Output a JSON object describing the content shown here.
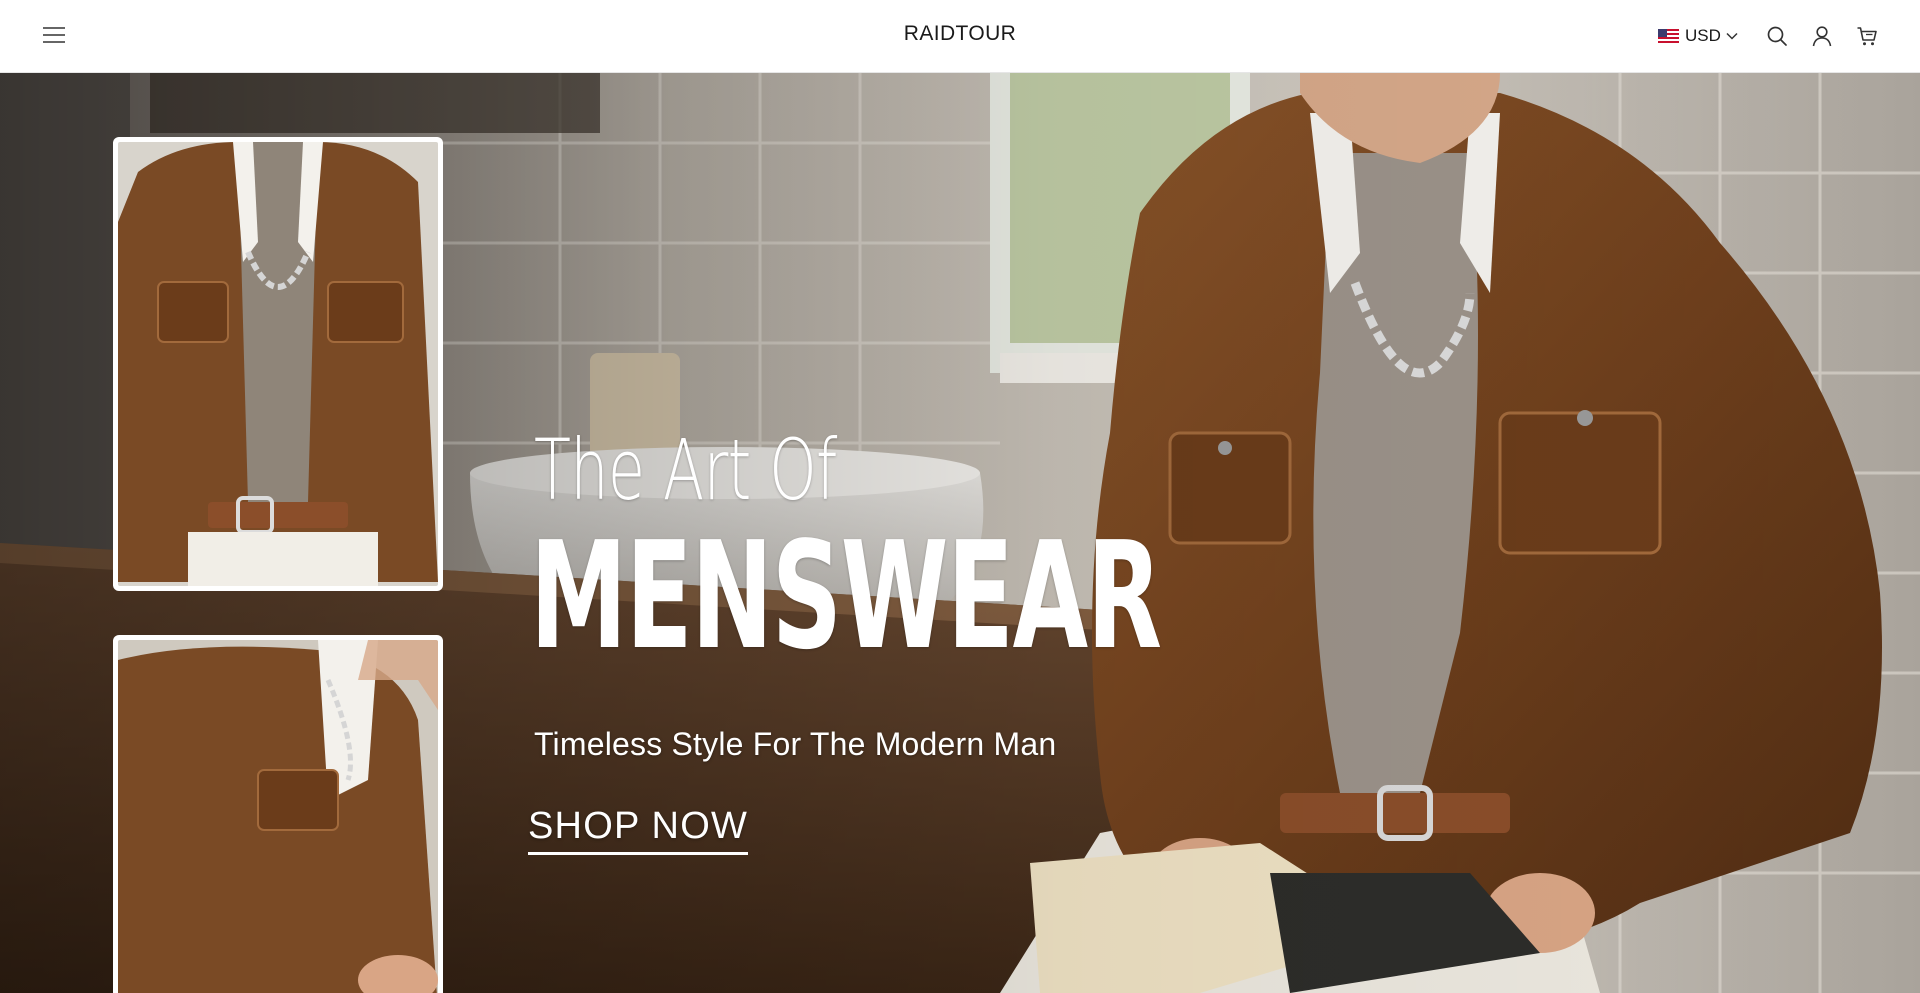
{
  "header": {
    "brand": "RAIDTOUR",
    "currency": {
      "code": "USD",
      "flag_icon": "us-flag-icon"
    },
    "icons": [
      "menu-icon",
      "search-icon",
      "account-icon",
      "cart-icon"
    ]
  },
  "hero": {
    "eyebrow": "The Art Of",
    "headline": "MENSWEAR",
    "subtitle": "Timeless Style For The Modern Man",
    "cta_label": "SHOP NOW",
    "images": [
      "suede-jacket-front-photo",
      "suede-jacket-side-photo",
      "man-reading-book-photo"
    ]
  },
  "colors": {
    "jacket_brown": "#7a4a25",
    "header_bg": "#ffffff",
    "text_dark": "#1a1a1a",
    "hero_text": "#ffffff"
  }
}
